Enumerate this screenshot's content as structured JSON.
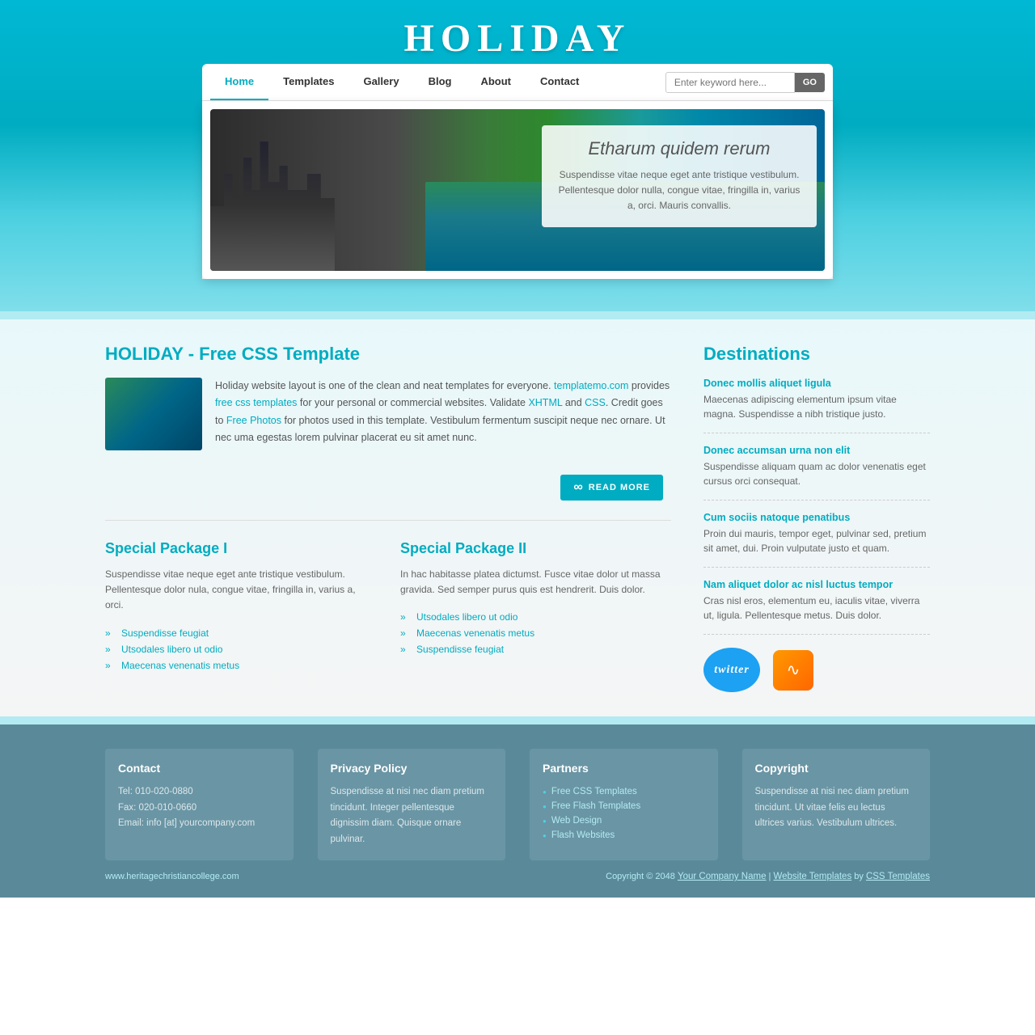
{
  "site": {
    "title": "HOLIDAY",
    "title_reflection": "HOLIDAY"
  },
  "nav": {
    "links": [
      {
        "label": "Home",
        "active": true
      },
      {
        "label": "Templates",
        "active": false
      },
      {
        "label": "Gallery",
        "active": false
      },
      {
        "label": "Blog",
        "active": false
      },
      {
        "label": "About",
        "active": false
      },
      {
        "label": "Contact",
        "active": false
      }
    ],
    "search_placeholder": "Enter keyword here...",
    "search_button": "GO"
  },
  "hero": {
    "heading": "Etharum quidem rerum",
    "text": "Suspendisse vitae neque eget ante tristique vestibulum. Pellentesque dolor nulla, congue vitae, fringilla in, varius a, orci. Mauris convallis."
  },
  "main": {
    "title": "HOLIDAY - Free CSS Template",
    "intro_para": "Holiday website layout is one of the clean and neat templates for everyone. templatemo.com provides free css templates for your personal or commercial websites. Validate XHTML and CSS. Credit goes to Free Photos for photos used in this template. Vestibulum fermentum suscipit neque nec ornare. Ut nec uma egestas lorem pulvinar placerat eu sit amet nunc.",
    "read_more": "READ MORE",
    "package1": {
      "title": "Special Package I",
      "text": "Suspendisse vitae neque eget ante tristique vestibulum. Pellentesque dolor nula, congue vitae, fringilla in, varius a, orci.",
      "items": [
        "Suspendisse feugiat",
        "Utsodales libero ut odio",
        "Maecenas venenatis metus"
      ]
    },
    "package2": {
      "title": "Special Package II",
      "text": "In hac habitasse platea dictumst. Fusce vitae dolor ut massa gravida. Sed semper purus quis est hendrerit. Duis dolor.",
      "items": [
        "Utsodales libero ut odio",
        "Maecenas venenatis metus",
        "Suspendisse feugiat"
      ]
    }
  },
  "sidebar": {
    "title": "Destinations",
    "items": [
      {
        "link": "Donec mollis aliquet ligula",
        "text": "Maecenas adipiscing elementum ipsum vitae magna. Suspendisse a nibh tristique justo."
      },
      {
        "link": "Donec accumsan urna non elit",
        "text": "Suspendisse aliquam quam ac dolor venenatis eget cursus orci consequat."
      },
      {
        "link": "Cum sociis natoque penatibus",
        "text": "Proin dui mauris, tempor eget, pulvinar sed, pretium sit amet, dui. Proin vulputate justo et quam."
      },
      {
        "link": "Nam aliquet dolor ac nisl luctus tempor",
        "text": "Cras nisl eros, elementum eu, iaculis vitae, viverra ut, ligula. Pellentesque metus. Duis dolor."
      }
    ],
    "twitter_label": "twitter",
    "rss_icon": "RSS"
  },
  "footer": {
    "cols": [
      {
        "title": "Contact",
        "lines": [
          "Tel: 010-020-0880",
          "Fax: 020-010-0660",
          "Email: info [at] yourcompany.com"
        ]
      },
      {
        "title": "Privacy Policy",
        "text": "Suspendisse at nisi nec diam pretium tincidunt. Integer pellentesque dignissim diam. Quisque ornare pulvinar."
      },
      {
        "title": "Partners",
        "links": [
          "Free CSS Templates",
          "Free Flash Templates",
          "Web Design",
          "Flash Websites"
        ]
      },
      {
        "title": "Copyright",
        "text": "Suspendisse at nisi nec diam pretium tincidunt. Ut vitae felis eu lectus ultrices varius. Vestibulum ultrices."
      }
    ],
    "bottom_left": "www.heritagechristiancollege.com",
    "copyright": "Copyright © 2048",
    "company_name": "Your Company Name",
    "separator1": "|",
    "website_templates": "Website Templates",
    "by": "by",
    "css_templates": "CSS Templates"
  }
}
